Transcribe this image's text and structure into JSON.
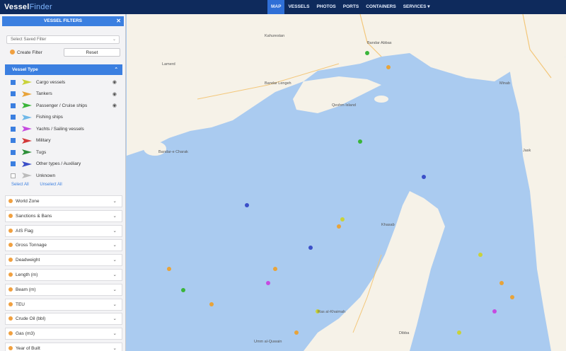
{
  "app": {
    "logo_main": "Vessel",
    "logo_accent": "Finder"
  },
  "nav": [
    "MAP",
    "VESSELS",
    "PHOTOS",
    "PORTS",
    "CONTAINERS",
    "SERVICES ▾"
  ],
  "panel": {
    "title": "VESSEL FILTERS",
    "close": "✕",
    "saved_filter_placeholder": "Select Saved Filter",
    "create_filter": "Create Filter",
    "reset": "Reset",
    "vessel_type_label": "Vessel Type",
    "vessel_types": [
      {
        "label": "Cargo vessels",
        "color": "#c9d23a",
        "checked": true
      },
      {
        "label": "Tankers",
        "color": "#e8a33a",
        "checked": true
      },
      {
        "label": "Passenger / Cruise ships",
        "color": "#3ab53a",
        "checked": true
      },
      {
        "label": "Fishing ships",
        "color": "#6fb8e8",
        "checked": true
      },
      {
        "label": "Yachts / Sailing vessels",
        "color": "#c64be0",
        "checked": true
      },
      {
        "label": "Military",
        "color": "#d23a3a",
        "checked": true
      },
      {
        "label": "Tugs",
        "color": "#2e8f3a",
        "checked": true
      },
      {
        "label": "Other types / Auxiliary",
        "color": "#3b4fc8",
        "checked": true
      },
      {
        "label": "Unknown",
        "color": "#bbbbbb",
        "checked": false
      }
    ],
    "select_all": "Select All",
    "unselect_all": "Unselect All",
    "sections": [
      "World Zone",
      "Sanctions & Bans",
      "AIS Flag",
      "Gross Tonnage",
      "Deadweight",
      "Length (m)",
      "Beam (m)",
      "TEU",
      "Crude Oil (bbl)",
      "Gas (m3)",
      "Year of Built"
    ]
  },
  "map": {
    "labels": [
      "Bandar Abbas",
      "Kahurestan",
      "Lamerd",
      "Bandar Lengeh",
      "Qeshm Island",
      "Minab",
      "Bandar-e Charak",
      "Khasab",
      "Ras al-Khaimah",
      "Dibba",
      "Umm al-Quwain",
      "Jask"
    ]
  }
}
